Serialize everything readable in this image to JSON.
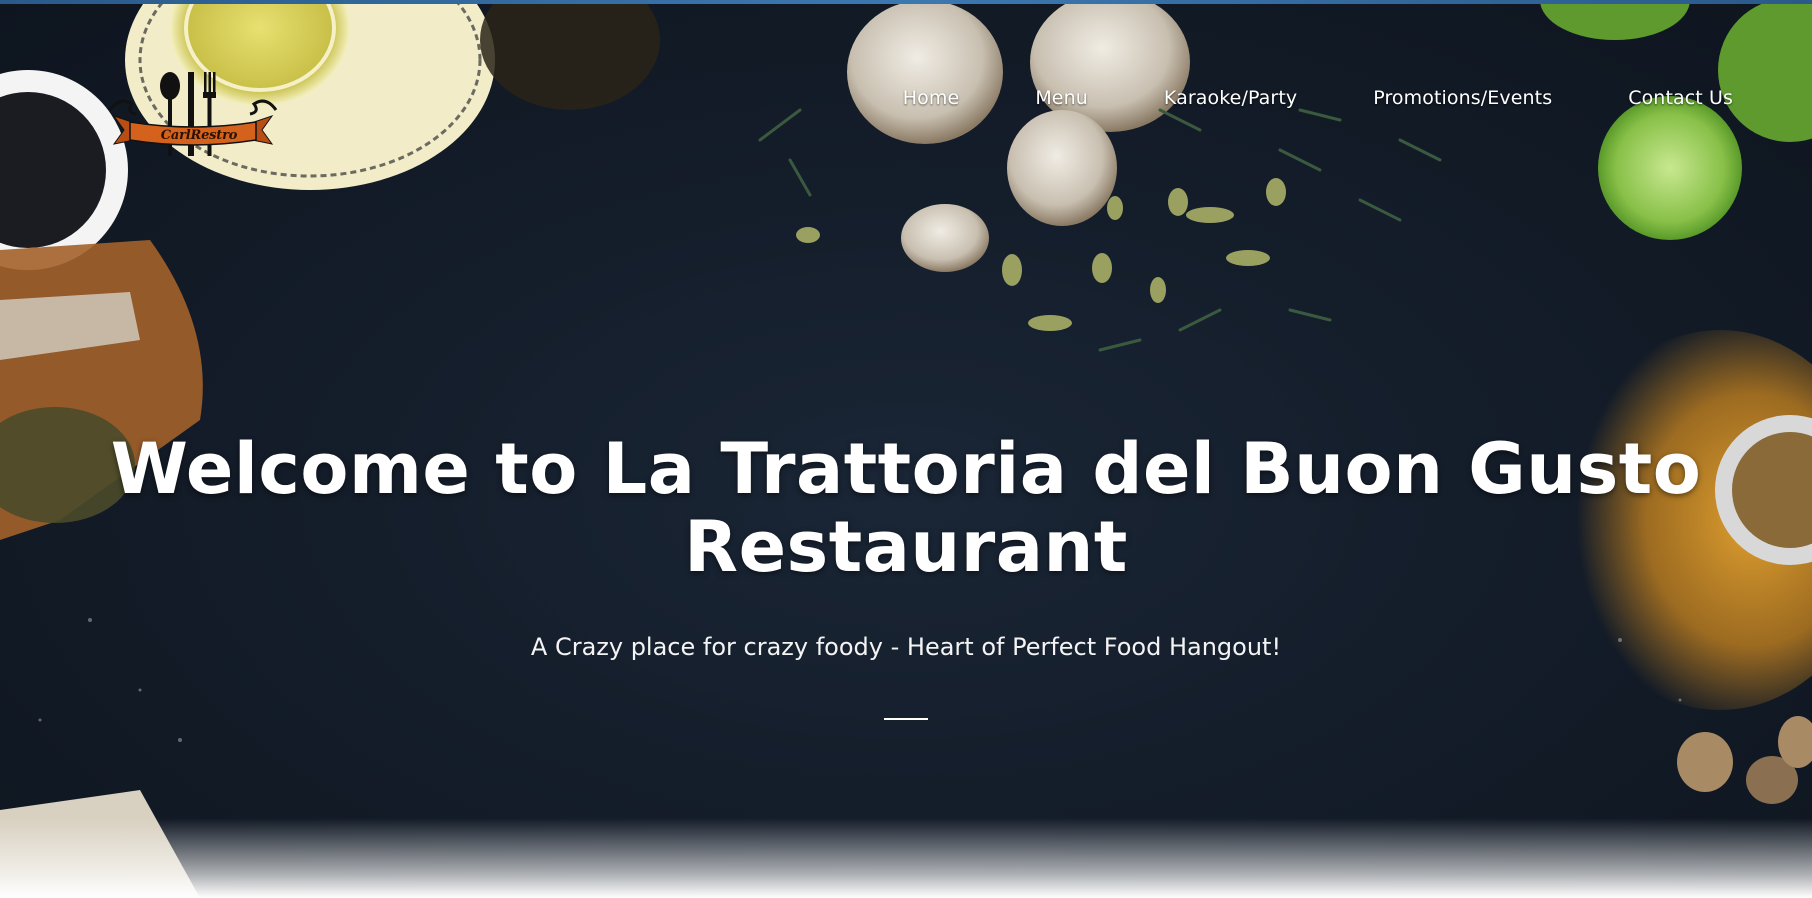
{
  "logo": {
    "text": "CarlRestro"
  },
  "nav": {
    "items": [
      {
        "label": "Home"
      },
      {
        "label": "Menu"
      },
      {
        "label": "Karaoke/Party"
      },
      {
        "label": "Promotions/Events"
      },
      {
        "label": "Contact Us"
      }
    ]
  },
  "hero": {
    "title": "Welcome to La Trattoria del Buon Gusto Restaurant",
    "subtitle": "A Crazy place for crazy foody - Heart of Perfect Food Hangout!"
  },
  "colors": {
    "background": "#141d2a",
    "text": "#ffffff",
    "top_strip": "#3c78b0",
    "logo_banner": "#d4621c"
  },
  "icons": [
    "fork-spoon-logo-icon"
  ]
}
